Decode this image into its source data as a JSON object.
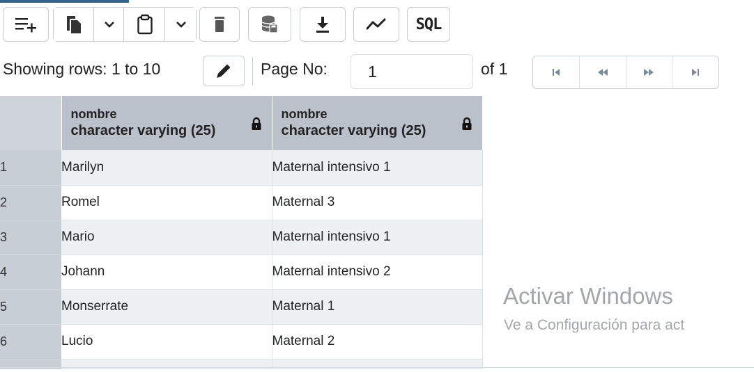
{
  "toolbar": {
    "sql_label": "SQL"
  },
  "pager": {
    "showing_label": "Showing rows: 1 to 10",
    "page_label": "Page No:",
    "page_value": "1",
    "of_label": "of 1"
  },
  "columns": [
    {
      "name": "nombre",
      "type": "character varying (25)"
    },
    {
      "name": "nombre",
      "type": "character varying (25)"
    }
  ],
  "rows": [
    {
      "num": "1",
      "c1": "Marilyn",
      "c2": "Maternal intensivo 1"
    },
    {
      "num": "2",
      "c1": "Romel",
      "c2": "Maternal 3"
    },
    {
      "num": "3",
      "c1": "Mario",
      "c2": "Maternal intensivo 1"
    },
    {
      "num": "4",
      "c1": "Johann",
      "c2": "Maternal intensivo 2"
    },
    {
      "num": "5",
      "c1": "Monserrate",
      "c2": "Maternal 1"
    },
    {
      "num": "6",
      "c1": "Lucio",
      "c2": "Maternal 2"
    }
  ],
  "watermark": {
    "title": "Activar Windows",
    "subtitle": "Ve a Configuración para act"
  },
  "colors": {
    "header_bg": "#bac1cb",
    "rownum_bg": "#c8ced6",
    "accent": "#326690"
  }
}
